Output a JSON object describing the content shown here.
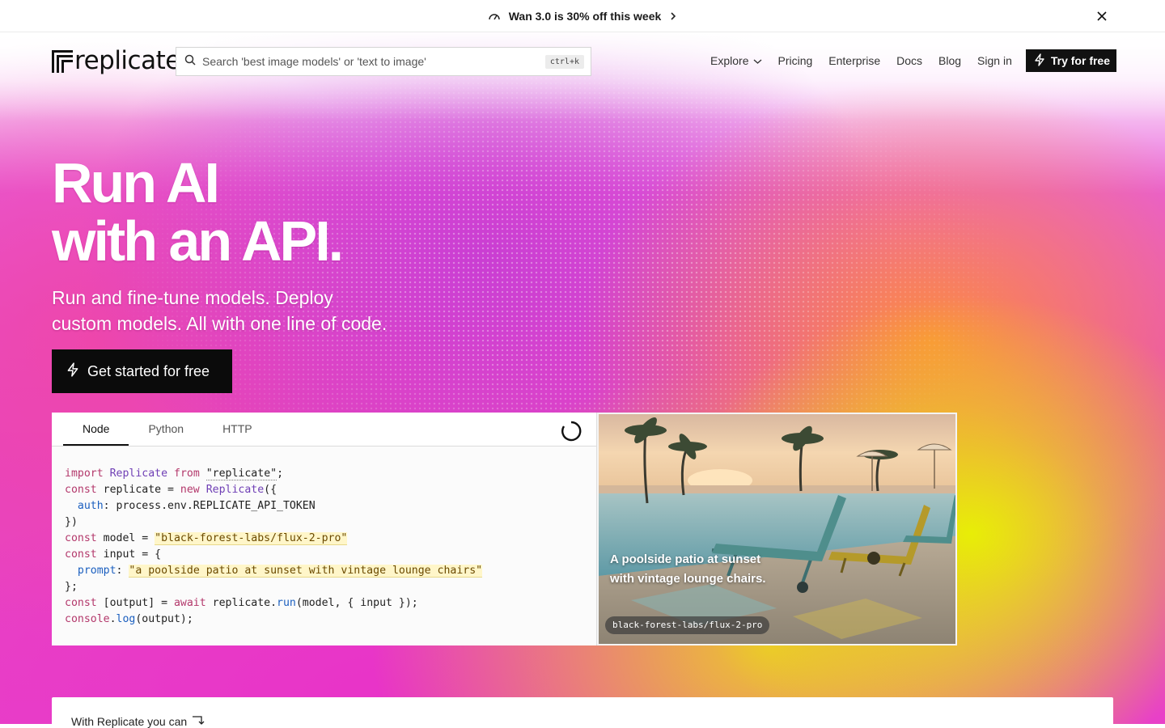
{
  "announcement": {
    "text": "Wan 3.0 is 30% off this week",
    "icon": "speedometer-icon",
    "chevron": "chevron-right-icon",
    "close": "close-icon"
  },
  "nav": {
    "logo_text": "replicate",
    "search": {
      "placeholder": "Search 'best image models' or 'text to image'",
      "value": "",
      "shortcut": "ctrl+k"
    },
    "links": {
      "explore": "Explore",
      "pricing": "Pricing",
      "enterprise": "Enterprise",
      "docs": "Docs",
      "blog": "Blog",
      "sign_in": "Sign in"
    },
    "try_button": "Try for free"
  },
  "hero": {
    "headline_line1": "Run AI",
    "headline_line2": "with an API.",
    "subhead_line1": "Run and fine-tune models. Deploy",
    "subhead_line2": "custom models. All with one line of code.",
    "cta": "Get started for free"
  },
  "code_card": {
    "tabs": [
      "Node",
      "Python",
      "HTTP"
    ],
    "active_tab": "Node",
    "code": {
      "l1_import": "import",
      "l1_cls": "Replicate",
      "l1_from": "from",
      "l1_str": "\"replicate\"",
      "l1_end": ";",
      "l2_const": "const",
      "l2_name": " replicate = ",
      "l2_new": "new",
      "l2_cls": "Replicate",
      "l2_end": "({",
      "l3_prop": "auth",
      "l3_val": ": process.env.REPLICATE_API_TOKEN",
      "l4": "})",
      "l5_const": "const",
      "l5_name": " model = ",
      "l5_str": "\"black-forest-labs/flux-2-pro\"",
      "l6_const": "const",
      "l6_name": " input = {",
      "l7_prop": "prompt",
      "l7_colon": ": ",
      "l7_str": "\"a poolside patio at sunset with vintage lounge chairs\"",
      "l8": "};",
      "l9_const": "const",
      "l9_mid": " [output] = ",
      "l9_await": "await",
      "l9_obj": " replicate.",
      "l9_fn": "run",
      "l9_end": "(model, { input });",
      "l10_obj": "console",
      "l10_dot": ".",
      "l10_fn": "log",
      "l10_end": "(output);"
    }
  },
  "image_card": {
    "caption": "A poolside patio at sunset with vintage lounge chairs.",
    "model_tag": "black-forest-labs/flux-2-pro"
  },
  "bottom": {
    "text": "With Replicate you can",
    "icon": "arrow-down-right-icon"
  },
  "colors": {
    "brand_dark": "#111111",
    "keyword": "#b3386b",
    "class": "#6f3fb5",
    "property": "#1b5fbf",
    "string_highlight": "#fff6c9"
  }
}
